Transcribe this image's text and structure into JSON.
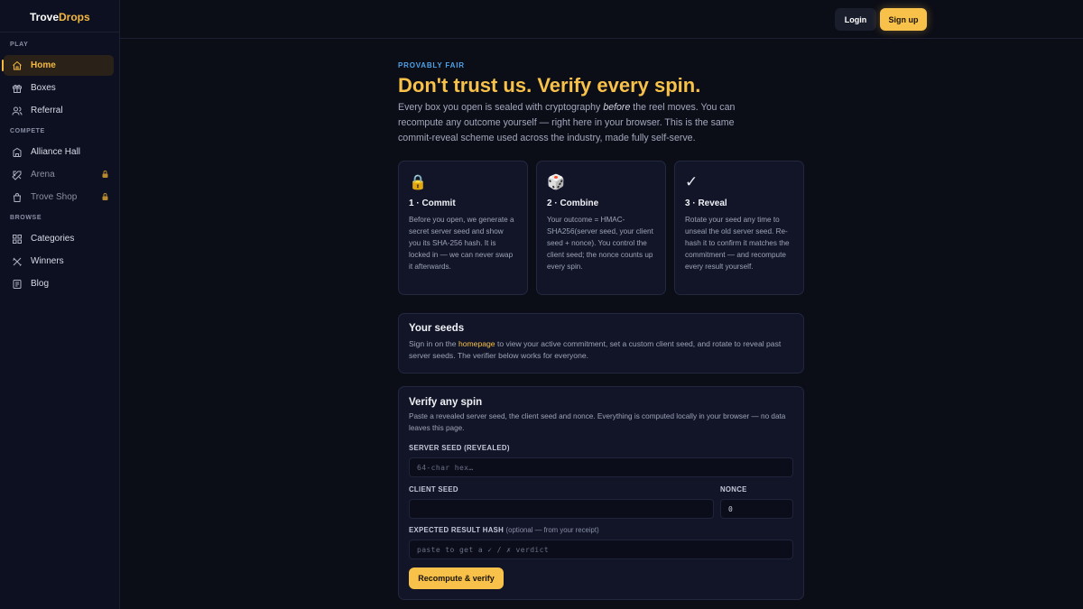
{
  "brand": {
    "name_a": "Trove",
    "name_b": "Drops",
    "accent": "#f7c14a"
  },
  "sidebar": {
    "sections": [
      {
        "label": "PLAY",
        "items": [
          {
            "label": "Home",
            "icon": "home-icon",
            "active": true
          },
          {
            "label": "Boxes",
            "icon": "gift-icon"
          },
          {
            "label": "Referral",
            "icon": "users-icon"
          }
        ]
      },
      {
        "label": "COMPETE",
        "items": [
          {
            "label": "Alliance Hall",
            "icon": "building-icon"
          },
          {
            "label": "Arena",
            "icon": "swords-icon",
            "locked": true
          },
          {
            "label": "Trove Shop",
            "icon": "shopping-bag-icon",
            "locked": true
          }
        ]
      },
      {
        "label": "BROWSE",
        "items": [
          {
            "label": "Categories",
            "icon": "grid-icon"
          },
          {
            "label": "Winners",
            "icon": "trophy-icon"
          },
          {
            "label": "Blog",
            "icon": "book-icon"
          }
        ]
      }
    ]
  },
  "header": {
    "login": "Login",
    "signup": "Sign up"
  },
  "hero": {
    "eyebrow": "PROVABLY FAIR",
    "title": "Don't trust us. Verify every spin.",
    "intro_a": "Every box you open is sealed with cryptography ",
    "intro_em": "before",
    "intro_b": " the reel moves. You can recompute any outcome yourself — right here in your browser. This is the same commit-reveal scheme used across the industry, made fully self-serve."
  },
  "steps": [
    {
      "icon": "🔒",
      "title": "1 · Commit",
      "body": "Before you open, we generate a secret server seed and show you its SHA-256 hash. It is locked in — we can never swap it afterwards."
    },
    {
      "icon": "🎲",
      "title": "2 · Combine",
      "body": "Your outcome = HMAC-SHA256(server seed, your client seed + nonce). You control the client seed; the nonce counts up every spin."
    },
    {
      "icon": "✓",
      "title": "3 · Reveal",
      "body": "Rotate your seed any time to unseal the old server seed. Re-hash it to confirm it matches the commitment — and recompute every result yourself."
    }
  ],
  "seeds": {
    "title": "Your seeds",
    "text_a": "Sign in on the ",
    "link": "homepage",
    "text_b": " to view your active commitment, set a custom client seed, and rotate to reveal past server seeds. The verifier below works for everyone."
  },
  "verify": {
    "title": "Verify any spin",
    "desc": "Paste a revealed server seed, the client seed and nonce. Everything is computed locally in your browser — no data leaves this page.",
    "server_label": "SERVER SEED (REVEALED)",
    "server_placeholder": "64-char hex…",
    "client_label": "CLIENT SEED",
    "client_value": "",
    "nonce_label": "NONCE",
    "nonce_value": "0",
    "hash_label": "EXPECTED RESULT HASH",
    "hash_optional": "(optional — from your receipt)",
    "hash_placeholder": "paste to get a ✓ / ✗ verdict",
    "button": "Recompute & verify"
  }
}
